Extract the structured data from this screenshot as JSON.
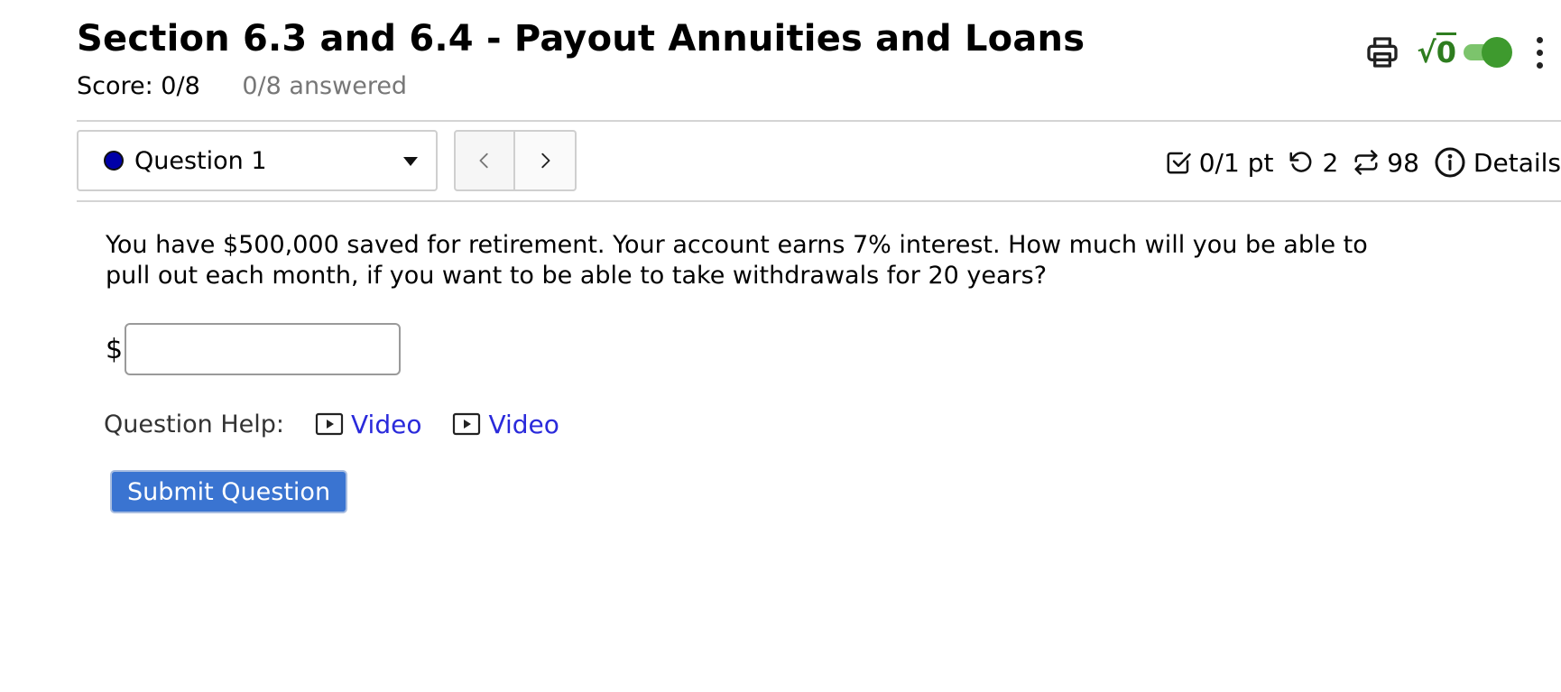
{
  "header": {
    "title": "Section 6.3 and 6.4 - Payout Annuities and Loans",
    "score": "Score: 0/8",
    "answered": "0/8 answered"
  },
  "toolbar": {
    "math_toggle_symbol": "√",
    "math_toggle_value": "0",
    "math_toggle_on": true,
    "icons": [
      "printer-icon",
      "kebab-menu-icon"
    ]
  },
  "question_nav": {
    "selected": "Question 1",
    "status_color": "#0000a8"
  },
  "question_meta": {
    "points": "0/1 pt",
    "retries": "2",
    "versions": "98",
    "details": "Details"
  },
  "question": {
    "text": "You have $500,000 saved for retirement. Your account earns 7% interest. How much will you be able to pull out each month, if you want to be able to take withdrawals for 20 years?",
    "currency_prefix": "$",
    "answer_value": ""
  },
  "help": {
    "label": "Question Help:",
    "links": [
      {
        "label": "Video"
      },
      {
        "label": "Video"
      }
    ]
  },
  "actions": {
    "submit_label": "Submit Question"
  },
  "colors": {
    "accent": "#3a74d1",
    "link": "#2a2adb",
    "toggle_on": "#3e9a2e"
  }
}
